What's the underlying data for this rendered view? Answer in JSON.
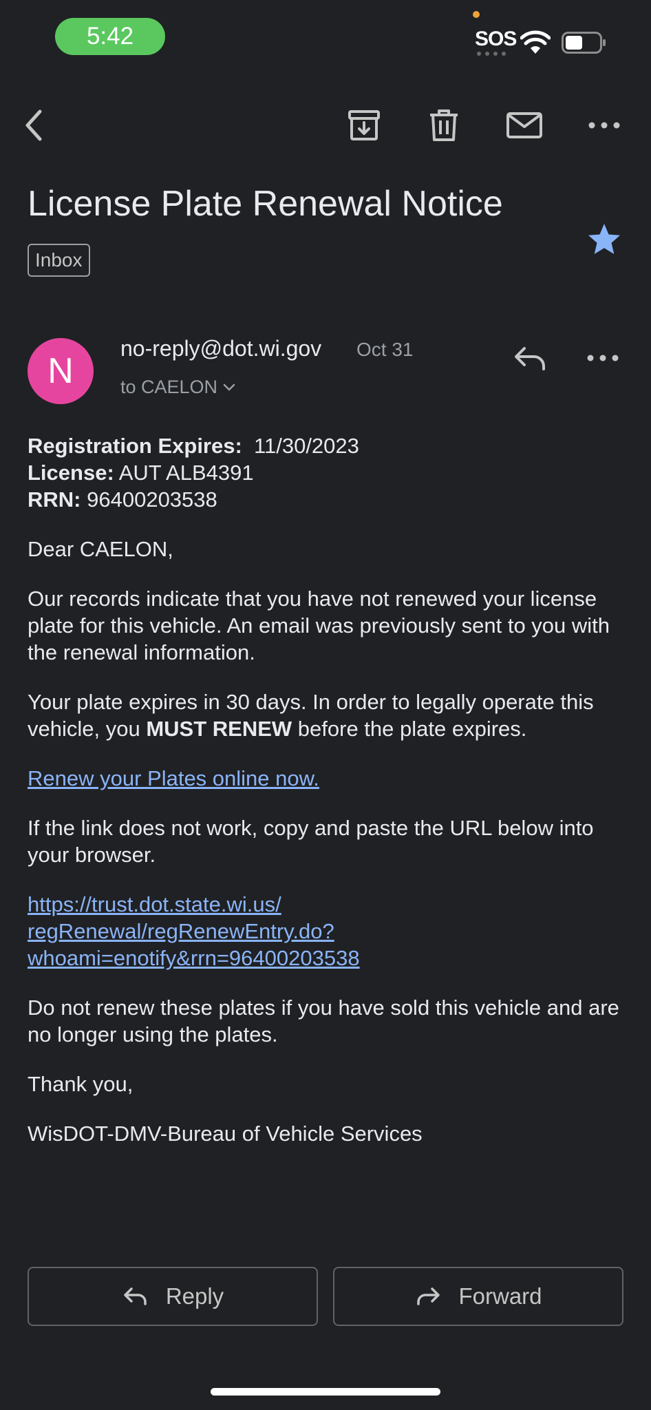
{
  "status_bar": {
    "time": "5:42",
    "sos": "SOS"
  },
  "email": {
    "subject": "License Plate Renewal Notice",
    "label": "Inbox",
    "starred": true,
    "sender": {
      "initial": "N",
      "address": "no-reply@dot.wi.gov",
      "date": "Oct 31",
      "to": "to CAELON",
      "avatar_color": "#e6459f"
    },
    "body": {
      "reg_label": "Registration Expires:",
      "reg_value": "11/30/2023",
      "license_label": "License:",
      "license_value": "AUT ALB4391",
      "rrn_label": "RRN:",
      "rrn_value": "96400203538",
      "greeting": "Dear CAELON,",
      "para1": "Our records indicate that you have not renewed your license plate for this vehicle. An email was previously sent to you with the renewal information.",
      "para2_pre": "Your plate expires in 30 days. In order to legally operate this vehicle, you",
      "para2_bold": "MUST RENEW",
      "para2_post": "before the plate expires.",
      "renew_link": "Renew your Plates online now.",
      "para3": "If the link does not work, copy and paste the URL below into your browser.",
      "url_line1": "https://trust.dot.state.wi.us/",
      "url_line2": "regRenewal/regRenewEntry.do?",
      "url_line3": "whoami=enotify&rrn=96400203538",
      "para4": "Do not renew these plates if you have sold this vehicle and are no longer using the plates.",
      "closing": "Thank you,",
      "signature": "WisDOT-DMV-Bureau of Vehicle Services"
    }
  },
  "actions": {
    "reply": "Reply",
    "forward": "Forward"
  },
  "colors": {
    "background": "#202124",
    "link": "#8ab4f8",
    "star": "#8ab4f8",
    "time_pill": "#5ac85f"
  }
}
